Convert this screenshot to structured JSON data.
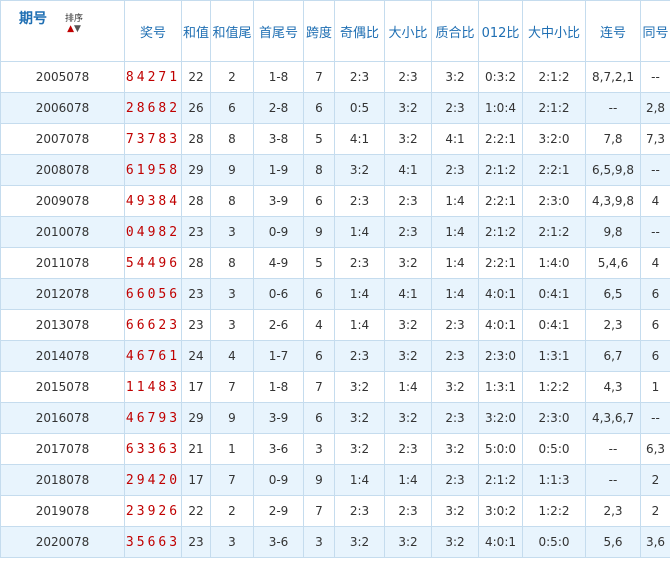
{
  "headers": {
    "issue": "期号",
    "sort": "排序",
    "draw": "奖号",
    "sum": "和值",
    "sum_tail": "和值尾",
    "head_tail": "首尾号",
    "span": "跨度",
    "odd_even": "奇偶比",
    "big_small": "大小比",
    "prime_composite": "质合比",
    "ratio_012": "012比",
    "big_mid_small": "大中小比",
    "consecutive": "连号",
    "same": "同号"
  },
  "rows": [
    {
      "issue": "2005078",
      "draw": "84271",
      "sum": "22",
      "sum_tail": "2",
      "head_tail": "1-8",
      "span": "7",
      "odd_even": "2:3",
      "big_small": "2:3",
      "prime_composite": "3:2",
      "ratio_012": "0:3:2",
      "big_mid_small": "2:1:2",
      "consecutive": "8,7,2,1",
      "same": "--"
    },
    {
      "issue": "2006078",
      "draw": "28682",
      "sum": "26",
      "sum_tail": "6",
      "head_tail": "2-8",
      "span": "6",
      "odd_even": "0:5",
      "big_small": "3:2",
      "prime_composite": "2:3",
      "ratio_012": "1:0:4",
      "big_mid_small": "2:1:2",
      "consecutive": "--",
      "same": "2,8"
    },
    {
      "issue": "2007078",
      "draw": "73783",
      "sum": "28",
      "sum_tail": "8",
      "head_tail": "3-8",
      "span": "5",
      "odd_even": "4:1",
      "big_small": "3:2",
      "prime_composite": "4:1",
      "ratio_012": "2:2:1",
      "big_mid_small": "3:2:0",
      "consecutive": "7,8",
      "same": "7,3"
    },
    {
      "issue": "2008078",
      "draw": "61958",
      "sum": "29",
      "sum_tail": "9",
      "head_tail": "1-9",
      "span": "8",
      "odd_even": "3:2",
      "big_small": "4:1",
      "prime_composite": "2:3",
      "ratio_012": "2:1:2",
      "big_mid_small": "2:2:1",
      "consecutive": "6,5,9,8",
      "same": "--"
    },
    {
      "issue": "2009078",
      "draw": "49384",
      "sum": "28",
      "sum_tail": "8",
      "head_tail": "3-9",
      "span": "6",
      "odd_even": "2:3",
      "big_small": "2:3",
      "prime_composite": "1:4",
      "ratio_012": "2:2:1",
      "big_mid_small": "2:3:0",
      "consecutive": "4,3,9,8",
      "same": "4"
    },
    {
      "issue": "2010078",
      "draw": "04982",
      "sum": "23",
      "sum_tail": "3",
      "head_tail": "0-9",
      "span": "9",
      "odd_even": "1:4",
      "big_small": "2:3",
      "prime_composite": "1:4",
      "ratio_012": "2:1:2",
      "big_mid_small": "2:1:2",
      "consecutive": "9,8",
      "same": "--"
    },
    {
      "issue": "2011078",
      "draw": "54496",
      "sum": "28",
      "sum_tail": "8",
      "head_tail": "4-9",
      "span": "5",
      "odd_even": "2:3",
      "big_small": "3:2",
      "prime_composite": "1:4",
      "ratio_012": "2:2:1",
      "big_mid_small": "1:4:0",
      "consecutive": "5,4,6",
      "same": "4"
    },
    {
      "issue": "2012078",
      "draw": "66056",
      "sum": "23",
      "sum_tail": "3",
      "head_tail": "0-6",
      "span": "6",
      "odd_even": "1:4",
      "big_small": "4:1",
      "prime_composite": "1:4",
      "ratio_012": "4:0:1",
      "big_mid_small": "0:4:1",
      "consecutive": "6,5",
      "same": "6"
    },
    {
      "issue": "2013078",
      "draw": "66623",
      "sum": "23",
      "sum_tail": "3",
      "head_tail": "2-6",
      "span": "4",
      "odd_even": "1:4",
      "big_small": "3:2",
      "prime_composite": "2:3",
      "ratio_012": "4:0:1",
      "big_mid_small": "0:4:1",
      "consecutive": "2,3",
      "same": "6"
    },
    {
      "issue": "2014078",
      "draw": "46761",
      "sum": "24",
      "sum_tail": "4",
      "head_tail": "1-7",
      "span": "6",
      "odd_even": "2:3",
      "big_small": "3:2",
      "prime_composite": "2:3",
      "ratio_012": "2:3:0",
      "big_mid_small": "1:3:1",
      "consecutive": "6,7",
      "same": "6"
    },
    {
      "issue": "2015078",
      "draw": "11483",
      "sum": "17",
      "sum_tail": "7",
      "head_tail": "1-8",
      "span": "7",
      "odd_even": "3:2",
      "big_small": "1:4",
      "prime_composite": "3:2",
      "ratio_012": "1:3:1",
      "big_mid_small": "1:2:2",
      "consecutive": "4,3",
      "same": "1"
    },
    {
      "issue": "2016078",
      "draw": "46793",
      "sum": "29",
      "sum_tail": "9",
      "head_tail": "3-9",
      "span": "6",
      "odd_even": "3:2",
      "big_small": "3:2",
      "prime_composite": "2:3",
      "ratio_012": "3:2:0",
      "big_mid_small": "2:3:0",
      "consecutive": "4,3,6,7",
      "same": "--"
    },
    {
      "issue": "2017078",
      "draw": "63363",
      "sum": "21",
      "sum_tail": "1",
      "head_tail": "3-6",
      "span": "3",
      "odd_even": "3:2",
      "big_small": "2:3",
      "prime_composite": "3:2",
      "ratio_012": "5:0:0",
      "big_mid_small": "0:5:0",
      "consecutive": "--",
      "same": "6,3"
    },
    {
      "issue": "2018078",
      "draw": "29420",
      "sum": "17",
      "sum_tail": "7",
      "head_tail": "0-9",
      "span": "9",
      "odd_even": "1:4",
      "big_small": "1:4",
      "prime_composite": "2:3",
      "ratio_012": "2:1:2",
      "big_mid_small": "1:1:3",
      "consecutive": "--",
      "same": "2"
    },
    {
      "issue": "2019078",
      "draw": "23926",
      "sum": "22",
      "sum_tail": "2",
      "head_tail": "2-9",
      "span": "7",
      "odd_even": "2:3",
      "big_small": "2:3",
      "prime_composite": "3:2",
      "ratio_012": "3:0:2",
      "big_mid_small": "1:2:2",
      "consecutive": "2,3",
      "same": "2"
    },
    {
      "issue": "2020078",
      "draw": "35663",
      "sum": "23",
      "sum_tail": "3",
      "head_tail": "3-6",
      "span": "3",
      "odd_even": "3:2",
      "big_small": "3:2",
      "prime_composite": "3:2",
      "ratio_012": "4:0:1",
      "big_mid_small": "0:5:0",
      "consecutive": "5,6",
      "same": "3,6"
    }
  ]
}
